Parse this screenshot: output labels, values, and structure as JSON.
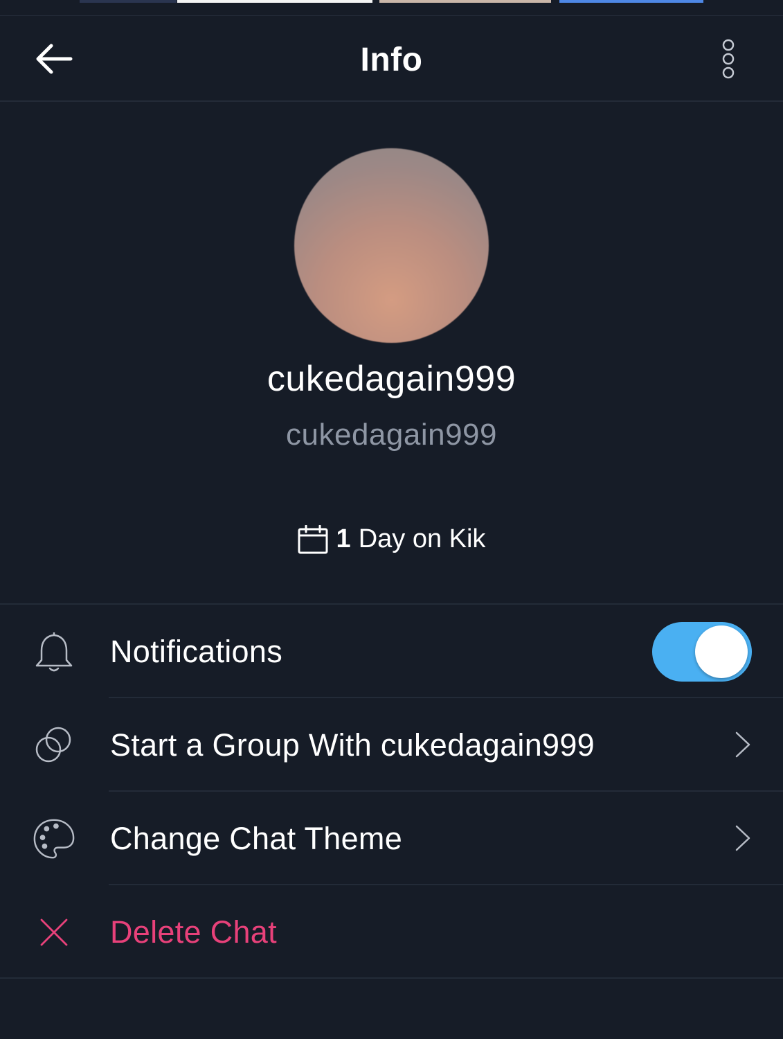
{
  "header": {
    "title": "Info"
  },
  "profile": {
    "display_name": "cukedagain999",
    "username": "cukedagain999",
    "days_count": "1",
    "days_label": "Day on Kik"
  },
  "settings": {
    "notifications_label": "Notifications",
    "notifications_enabled": true,
    "start_group_label": "Start a Group With cukedagain999",
    "change_theme_label": "Change Chat Theme",
    "delete_chat_label": "Delete Chat"
  },
  "icons": {
    "back": "arrow-left-icon",
    "more": "more-vertical-icon",
    "calendar": "calendar-icon",
    "notifications": "bell-icon",
    "group": "group-circles-icon",
    "theme": "palette-icon",
    "delete": "close-icon",
    "chevron": "chevron-right-icon"
  },
  "colors": {
    "background": "#161c27",
    "divider": "#232b38",
    "secondary_text": "#8e96a4",
    "toggle_on": "#4ab0f2",
    "danger": "#e8417a"
  }
}
